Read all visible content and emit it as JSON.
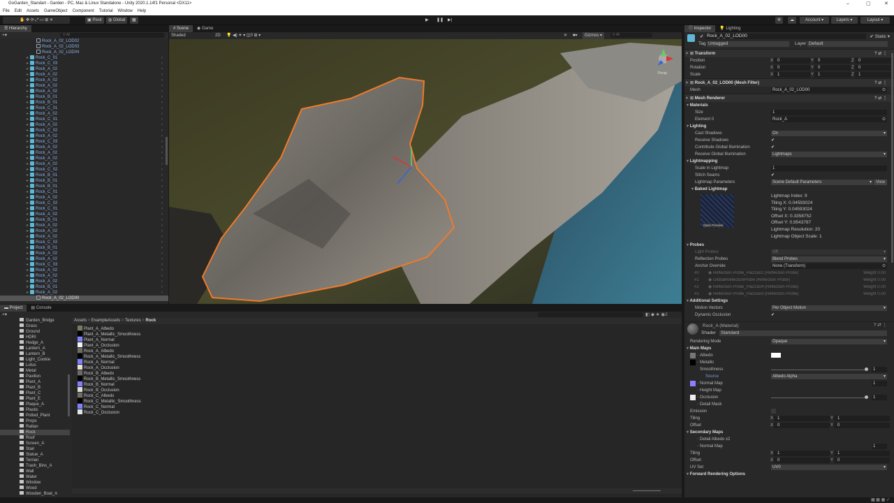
{
  "window": {
    "title": "GoGarden_Standart - Garden - PC, Mac & Linux Standalone - Unity 2020.1.14f1 Personal <DX11>",
    "controls": [
      "–",
      "▢",
      "✕"
    ]
  },
  "menu": [
    "File",
    "Edit",
    "Assets",
    "GameObject",
    "Component",
    "Tutorial",
    "Window",
    "Help"
  ],
  "toolbar": {
    "pivot": "Pivot",
    "global": "Global",
    "account": "Account",
    "layers": "Layers",
    "layout": "Layout"
  },
  "hierarchy": {
    "tab": "Hierarchy",
    "search_placeholder": "All",
    "lod_items": [
      "Rock_A_02_LOD02",
      "Rock_A_02_LOD03",
      "Rock_A_02_LOD04"
    ],
    "items": [
      "Rock_C_01",
      "Rock_C_03",
      "Rock_A_02",
      "Rock_A_02",
      "Rock_A_02",
      "Rock_A_02",
      "Rock_A_02",
      "Rock_B_01",
      "Rock_B_01",
      "Rock_C_01",
      "Rock_A_02",
      "Rock_C_01",
      "Rock_A_02",
      "Rock_C_02",
      "Rock_A_02",
      "Rock_C_03",
      "Rock_A_02",
      "Rock_A_02",
      "Rock_A_02",
      "Rock_A_02",
      "Rock_C_02",
      "Rock_B_01",
      "Rock_B_01",
      "Rock_B_01",
      "Rock_C_01",
      "Rock_A_02",
      "Rock_C_02",
      "Rock_C_01",
      "Rock_A_02",
      "Rock_B_01",
      "Rock_A_02",
      "Rock_A_02",
      "Rock_A_02",
      "Rock_C_02",
      "Rock_B_01",
      "Rock_A_02",
      "Rock_A_02",
      "Rock_C_03",
      "Rock_A_02",
      "Rock_A_02",
      "Rock_A_02",
      "Rock_B_01",
      "Rock_A_02"
    ],
    "selected": "Rock_A_02_LOD00"
  },
  "scene": {
    "tabs": [
      "Scene",
      "Game"
    ],
    "shading": "Shaded",
    "mode2d": "2D",
    "gizmos": "Gizmos",
    "search_placeholder": "All",
    "persp": "Persp"
  },
  "project": {
    "tabs": [
      "Project",
      "Console"
    ],
    "folders": [
      "Garden_Bridge",
      "Grass",
      "Ground",
      "HDRI",
      "Hedge_A",
      "Lantern_A",
      "Lantern_B",
      "Light_Cookie",
      "Lotus",
      "Metal",
      "Pavilion",
      "Plant_A",
      "Plant_B",
      "Plant_C",
      "Plant_E",
      "Plaque_A",
      "Plastic",
      "Potted_Plant",
      "Props",
      "Rattan",
      "Rock",
      "Roof",
      "Screen_A",
      "Stair",
      "Statue_A",
      "Terrian",
      "Trash_Bins_A",
      "Wall",
      "Water",
      "Window",
      "Wood",
      "Wooden_Boat_A"
    ],
    "selected_folder": "Rock",
    "breadcrumb": [
      "Assets",
      "ExampleAssets",
      "Textures",
      "Rock"
    ],
    "files": [
      {
        "name": "Plant_A_Albedo",
        "color": "#7a7a62"
      },
      {
        "name": "Plant_A_Metallic_Smoothness",
        "color": "#000000"
      },
      {
        "name": "Plant_A_Normal",
        "color": "#8080ff"
      },
      {
        "name": "Plant_A_Occlusion",
        "color": "#f4f4f4"
      },
      {
        "name": "Rock_A_Albedo",
        "color": "#6e6a64"
      },
      {
        "name": "Rock_A_Metallic_Smoothness",
        "color": "#000000"
      },
      {
        "name": "Rock_A_Normal",
        "color": "#8080ff"
      },
      {
        "name": "Rock_A_Occlusion",
        "color": "#e0e0e0"
      },
      {
        "name": "Rock_B_Albedo",
        "color": "#6b6a62"
      },
      {
        "name": "Rock_B_Metallic_Smoothness",
        "color": "#000000"
      },
      {
        "name": "Rock_B_Normal",
        "color": "#8080ff"
      },
      {
        "name": "Rock_B_Occlusion",
        "color": "#dcdcdc"
      },
      {
        "name": "Rock_C_Albedo",
        "color": "#6f6d60"
      },
      {
        "name": "Rock_C_Metallic_Smoothness",
        "color": "#000000"
      },
      {
        "name": "Rock_C_Normal",
        "color": "#8080ff"
      },
      {
        "name": "Rock_C_Occlusion",
        "color": "#e4e4e4"
      }
    ],
    "hidden_count": "2"
  },
  "inspector": {
    "tabs": [
      "Inspector",
      "Lighting"
    ],
    "object_name": "Rock_A_02_LOD00",
    "static": "Static",
    "tag_label": "Tag",
    "tag": "Untagged",
    "layer_label": "Layer",
    "layer": "Default",
    "rows": [
      {
        "t": "comp",
        "label": "Transform"
      },
      {
        "t": "xyz",
        "label": "Position",
        "v": [
          "0",
          "0",
          "0"
        ]
      },
      {
        "t": "xyz",
        "label": "Rotation",
        "v": [
          "0",
          "0",
          "0"
        ]
      },
      {
        "t": "xyz",
        "label": "Scale",
        "v": [
          "1",
          "1",
          "1"
        ]
      },
      {
        "t": "comp",
        "label": "Rock_A_02_LOD00 (Mesh Filter)"
      },
      {
        "t": "obj",
        "label": "Mesh",
        "v": "Rock_A_02_LOD00"
      },
      {
        "t": "comp",
        "label": "Mesh Renderer"
      },
      {
        "t": "sec",
        "label": "Materials"
      },
      {
        "t": "text",
        "label": "Size",
        "v": "1",
        "sub": true
      },
      {
        "t": "obj",
        "label": "Element 0",
        "v": "Rock_A",
        "sub": true
      },
      {
        "t": "sec",
        "label": "Lighting"
      },
      {
        "t": "dd",
        "label": "Cast Shadows",
        "v": "On",
        "sub": true
      },
      {
        "t": "check",
        "label": "Receive Shadows",
        "sub": true
      },
      {
        "t": "check",
        "label": "Contribute Global Illumination",
        "sub": true
      },
      {
        "t": "dd",
        "label": "Receive Global Illumination",
        "v": "Lightmaps",
        "sub": true
      },
      {
        "t": "sec",
        "label": "Lightmapping"
      },
      {
        "t": "text",
        "label": "Scale In Lightmap",
        "v": "1",
        "sub": true
      },
      {
        "t": "check",
        "label": "Stitch Seams",
        "sub": true
      },
      {
        "t": "dd",
        "label": "Lightmap Parameters",
        "v": "Scene Default Parameters",
        "sub": true,
        "btn": "View"
      },
      {
        "t": "sec",
        "label": "Baked Lightmap",
        "sub": true
      },
      {
        "t": "lightmap",
        "preview": "Open Preview",
        "info": [
          "Lightmap Index: 9",
          "Tiling X: 0.04593024",
          "Tiling Y: 0.04593024",
          "Offset X: 0.3358752",
          "Offset Y: 0.9543787",
          "Lightmap Resolution: 20",
          "Lightmap Object Scale: 1"
        ]
      },
      {
        "t": "sec",
        "label": "Probes"
      },
      {
        "t": "dd",
        "label": "Light Probes",
        "v": "Off",
        "sub": true,
        "dim": true
      },
      {
        "t": "dd",
        "label": "Reflection Probes",
        "v": "Blend Probes",
        "sub": true
      },
      {
        "t": "obj",
        "label": "Anchor Override",
        "v": "None (Transform)",
        "sub": true
      },
      {
        "t": "probe",
        "label": "#0",
        "v": "Reflection Probe_Piazza02 (Reflection Probe)",
        "w": "Weight 0.00"
      },
      {
        "t": "probe",
        "label": "#1",
        "v": "GlobalReflectionProbe (Reflection Probe)",
        "w": "Weight 0.00"
      },
      {
        "t": "probe",
        "label": "#2",
        "v": "Reflection Probe_Piazza04 (Reflection Probe)",
        "w": "Weight 0.00"
      },
      {
        "t": "probe",
        "label": "#3",
        "v": "Reflection Probe_Piazza03 (Reflection Probe)",
        "w": "Weight 0.00"
      },
      {
        "t": "sec",
        "label": "Additional Settings"
      },
      {
        "t": "dd",
        "label": "Motion Vectors",
        "v": "Per Object Motion",
        "sub": true
      },
      {
        "t": "check",
        "label": "Dynamic Occlusion",
        "sub": true
      },
      {
        "t": "material",
        "label": "Rock_A (Material)",
        "shader_label": "Shader",
        "shader": "Standard"
      },
      {
        "t": "dd",
        "label": "Rendering Mode",
        "v": "Opaque"
      },
      {
        "t": "sec",
        "label": "Main Maps"
      },
      {
        "t": "map",
        "label": "Albedo",
        "sw": "#777777",
        "color": true
      },
      {
        "t": "map",
        "label": "Metallic",
        "sw": "#000000"
      },
      {
        "t": "slider",
        "label": "Smoothness",
        "v": "1",
        "sub2": true
      },
      {
        "t": "dd",
        "label": "Source",
        "v": "Albedo Alpha",
        "sub2": true,
        "blue": true
      },
      {
        "t": "map",
        "label": "Normal Map",
        "sw": "#8a80ff",
        "num": "1"
      },
      {
        "t": "map",
        "label": "Height Map"
      },
      {
        "t": "map",
        "label": "Occlusion",
        "sw": "#eeeeee",
        "slider": "1"
      },
      {
        "t": "map",
        "label": "Detail Mask"
      },
      {
        "t": "emis",
        "label": "Emission"
      },
      {
        "t": "xy",
        "label": "Tiling",
        "v": [
          "1",
          "1"
        ]
      },
      {
        "t": "xy",
        "label": "Offset",
        "v": [
          "0",
          "0"
        ]
      },
      {
        "t": "sec",
        "label": "Secondary Maps"
      },
      {
        "t": "map",
        "label": "Detail Albedo x2"
      },
      {
        "t": "map",
        "label": "Normal Map",
        "num": "1"
      },
      {
        "t": "xy",
        "label": "Tiling",
        "v": [
          "1",
          "1"
        ]
      },
      {
        "t": "xy",
        "label": "Offset",
        "v": [
          "0",
          "0"
        ]
      },
      {
        "t": "dd",
        "label": "UV Set",
        "v": "UV0"
      },
      {
        "t": "sec",
        "label": "Forward Rendering Options"
      }
    ]
  },
  "colors": {
    "selection_outline": "#f07a2a",
    "panel": "#282828",
    "accent": "#8fb3e8"
  }
}
